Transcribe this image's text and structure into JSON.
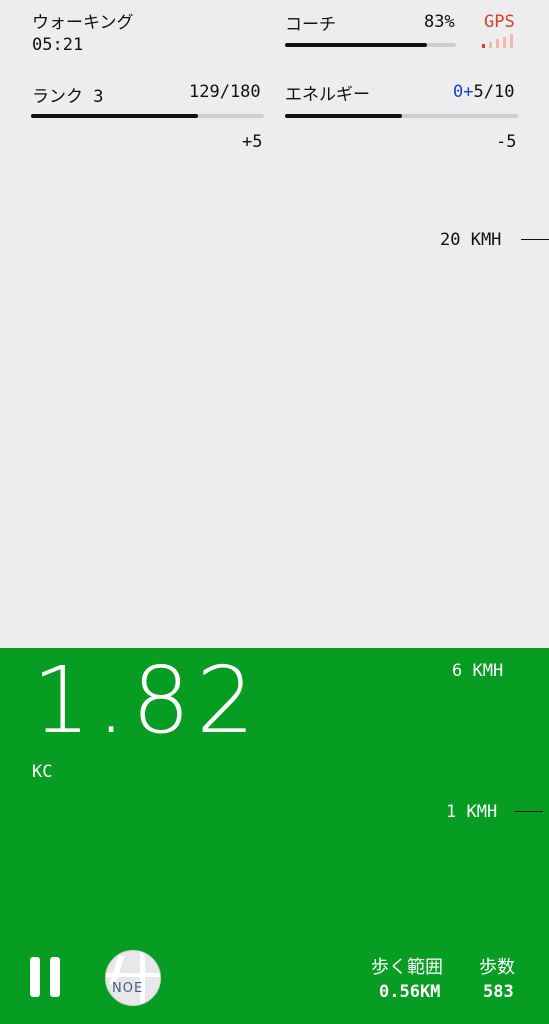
{
  "activity": {
    "name": "ウォーキング",
    "time": "05:21"
  },
  "coach": {
    "label": "コーチ",
    "percent_text": "83%",
    "progress": 0.83
  },
  "gps": {
    "label": "GPS",
    "label_color": "#e03a2f",
    "signal_bars_active": 1,
    "signal_bars_total": 5
  },
  "rank": {
    "label": "ランク 3",
    "value": "129/180",
    "progress": 0.717,
    "delta": "+5"
  },
  "energy": {
    "label": "エネルギー",
    "gain": "0+",
    "gain_color": "#1a3fd6",
    "value": "5/10",
    "progress": 0.5,
    "delta": "-5"
  },
  "speed_markers": {
    "top": "20 KMH",
    "mid": "6 KMH",
    "low": "1 KMH"
  },
  "main_metric": {
    "value": "1.82",
    "unit": "KC"
  },
  "stats": {
    "distance_label": "歩く範囲",
    "distance_value": "0.56KM",
    "steps_label": "歩数",
    "steps_value": "583"
  },
  "map_thumb_text": "NOE",
  "colors": {
    "panel_green": "#079c22",
    "background": "#eeedee"
  }
}
